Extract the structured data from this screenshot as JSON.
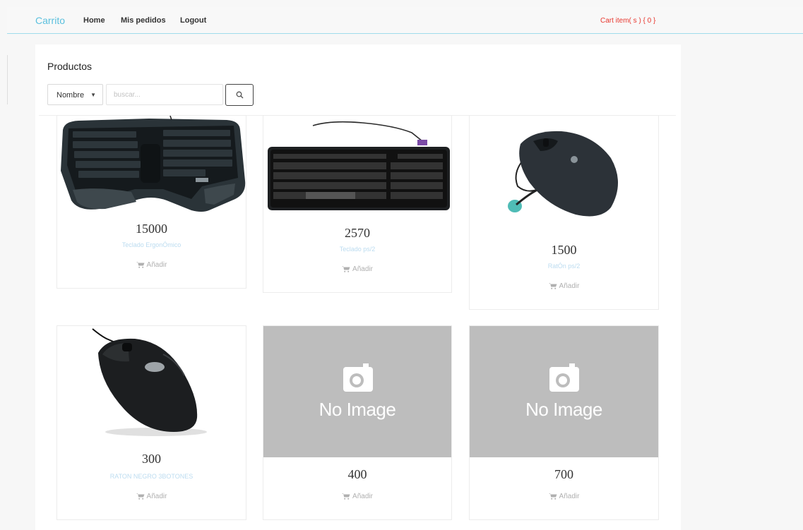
{
  "navbar": {
    "brand": "Carrito",
    "links": [
      "Home",
      "Mis pedidos",
      "Logout"
    ],
    "cart_text": "Cart item( s ) { 0 }"
  },
  "main": {
    "title": "Productos",
    "filter": {
      "selected": "Nombre"
    },
    "search": {
      "placeholder": "buscar..."
    },
    "products": [
      {
        "price": "15000",
        "name": "Teclado ErgonÓmico",
        "add_label": "Añadir",
        "image": "keyboard-ergonomic"
      },
      {
        "price": "2570",
        "name": "Teclado ps/2",
        "add_label": "Añadir",
        "image": "keyboard-ps2"
      },
      {
        "price": "1500",
        "name": "RatÓn ps/2",
        "add_label": "Añadir",
        "image": "mouse-ps2"
      },
      {
        "price": "300",
        "name": "RATON NEGRO 3BOTONES",
        "add_label": "Añadir",
        "image": "mouse-black"
      },
      {
        "price": "400",
        "name": "",
        "add_label": "Añadir",
        "image": "no-image",
        "no_image_text": "No Image"
      },
      {
        "price": "700",
        "name": "",
        "add_label": "Añadir",
        "image": "no-image",
        "no_image_text": "No Image"
      }
    ]
  },
  "colors": {
    "brand": "#5bc0de",
    "cart_text": "#e8372e",
    "product_name": "#bcdcf0",
    "no_image_bg": "#bdbdbd"
  },
  "icons": [
    "search-icon",
    "cart-icon",
    "camera-icon",
    "select-caret-icon"
  ]
}
